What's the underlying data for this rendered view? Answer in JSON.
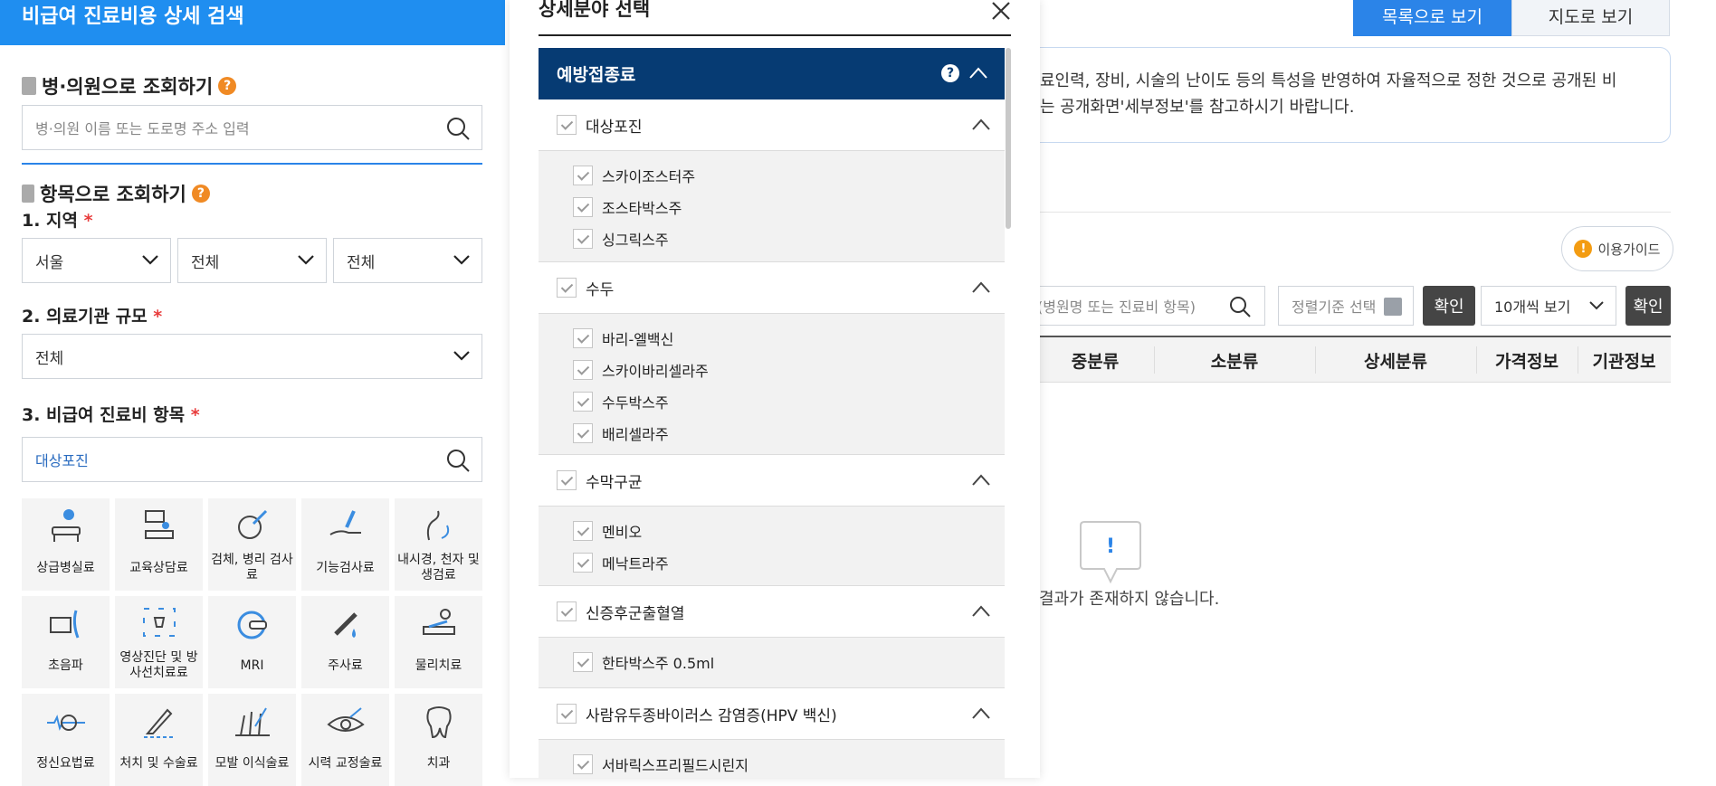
{
  "left_panel": {
    "header": "비급여 진료비용 상세 검색",
    "hospital_search": {
      "title": "병·의원으로 조회하기",
      "placeholder": "병·의원 이름 또는 도로명 주소 입력"
    },
    "item_search": {
      "title": "항목으로 조회하기",
      "region_label": "1. 지역",
      "region_selects": [
        "서울",
        "전체",
        "전체"
      ],
      "scale_label": "2. 의료기관 규모",
      "scale_select": "전체",
      "item_label": "3. 비급여 진료비 항목",
      "item_value": "대상포진",
      "required_mark": "*"
    },
    "categories": [
      {
        "label": "상급병실료",
        "icon": "hospital-bed-icon"
      },
      {
        "label": "교육상담료",
        "icon": "counseling-icon"
      },
      {
        "label": "검체, 병리 검사료",
        "icon": "microscope-icon"
      },
      {
        "label": "기능검사료",
        "icon": "function-test-icon"
      },
      {
        "label": "내시경, 천자 및 생검료",
        "icon": "endoscope-icon"
      },
      {
        "label": "초음파",
        "icon": "ultrasound-icon"
      },
      {
        "label": "영상진단 및 방사선치료료",
        "icon": "radiology-icon"
      },
      {
        "label": "MRI",
        "icon": "mri-icon"
      },
      {
        "label": "주사료",
        "icon": "syringe-icon"
      },
      {
        "label": "물리치료",
        "icon": "physical-therapy-icon"
      },
      {
        "label": "정신요법료",
        "icon": "brain-wave-icon"
      },
      {
        "label": "처치 및 수술료",
        "icon": "scalpel-icon"
      },
      {
        "label": "모발 이식술료",
        "icon": "hair-transplant-icon"
      },
      {
        "label": "시력 교정술료",
        "icon": "eye-icon"
      },
      {
        "label": "치과",
        "icon": "tooth-icon"
      }
    ]
  },
  "modal": {
    "title": "상세분야 선택",
    "category": "예방접종료",
    "groups": [
      {
        "name": "대상포진",
        "items": [
          "스카이조스터주",
          "조스타박스주",
          "싱그릭스주"
        ]
      },
      {
        "name": "수두",
        "items": [
          "바리-엘백신",
          "스카이바리셀라주",
          "수두박스주",
          "배리셀라주"
        ]
      },
      {
        "name": "수막구균",
        "items": [
          "멘비오",
          "메낙트라주"
        ]
      },
      {
        "name": "신증후군출혈열",
        "items": [
          "한타박스주 0.5ml"
        ]
      },
      {
        "name": "사람유두종바이러스 감염증(HPV 백신)",
        "items": [
          "서바릭스프리필드시린지"
        ]
      }
    ]
  },
  "main": {
    "view_tabs": [
      "목록으로 보기",
      "지도로 보기"
    ],
    "notice_lines": [
      "료인력, 장비, 시술의 난이도 등의 특성을 반영하여 자율적으로 정한 것으로 공개된 비",
      "는 공개화면'세부정보'를 참고하시기 바랍니다."
    ],
    "guide_label": "이용가이드",
    "search_placeholder": "(병원명 또는 진료비 항목)",
    "sort_placeholder": "정렬기준 선택",
    "confirm_label": "확인",
    "per_page": "10개씩 보기",
    "columns": [
      "중분류",
      "소분류",
      "상세분류",
      "가격정보",
      "기관정보"
    ],
    "empty_message": "결과가 존재하지 않습니다."
  },
  "colors": {
    "primary": "#1f8ef0",
    "navy": "#063b73",
    "required": "#e83c3c",
    "help": "#f08a24"
  }
}
